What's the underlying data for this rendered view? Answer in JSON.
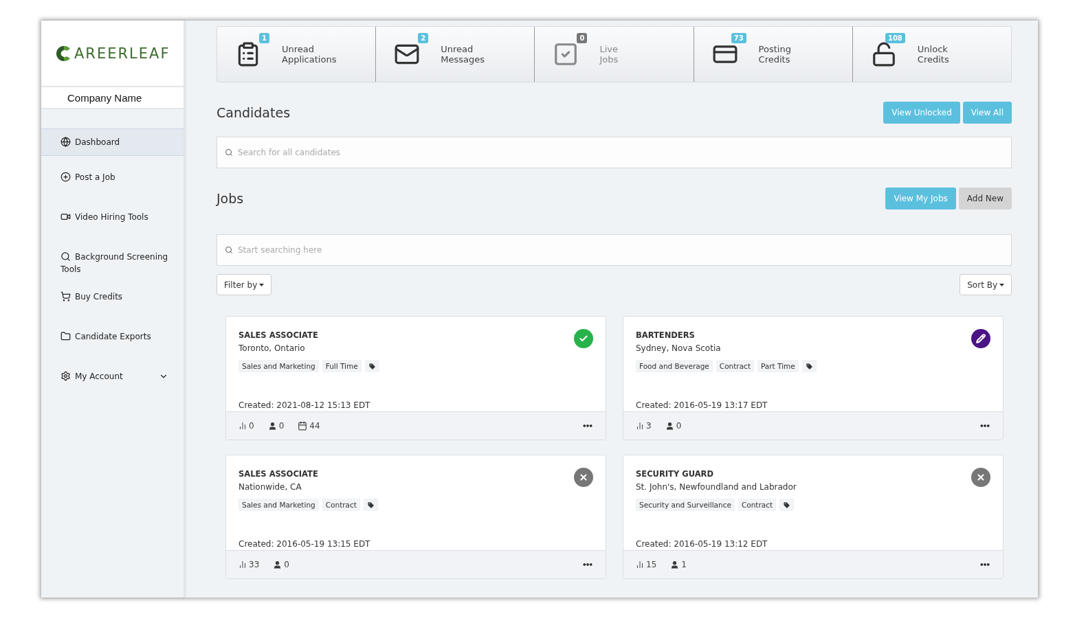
{
  "sidebar": {
    "logo": "AREERLEAF",
    "company": "Company Name",
    "items": [
      {
        "kind": "dashboard",
        "label": "Dashboard",
        "selected": true
      },
      {
        "kind": "post",
        "label": "Post a Job",
        "selected": false
      },
      {
        "kind": "video",
        "label": "Video Hiring Tools",
        "selected": false
      },
      {
        "kind": "screening",
        "label": "Background Screening Tools",
        "selected": false
      },
      {
        "kind": "credits",
        "label": "Buy Credits",
        "selected": false
      },
      {
        "kind": "exports",
        "label": "Candidate Exports",
        "selected": false
      },
      {
        "kind": "account",
        "label": "My Account",
        "selected": false,
        "expanded": false
      }
    ]
  },
  "stats": [
    {
      "kind": "applications",
      "count": "1",
      "label": [
        "Unread",
        "Applications"
      ],
      "muted": false
    },
    {
      "kind": "messages",
      "count": "2",
      "label": [
        "Unread",
        "Messages"
      ],
      "muted": false
    },
    {
      "kind": "jobs",
      "count": "0",
      "label": [
        "Live",
        "Jobs"
      ],
      "muted": true
    },
    {
      "kind": "posting",
      "count": "73",
      "label": [
        "Posting",
        "Credits"
      ],
      "muted": false
    },
    {
      "kind": "unlock",
      "count": "108",
      "label": [
        "Unlock",
        "Credits"
      ],
      "muted": false
    }
  ],
  "candidates": {
    "title": "Candidates",
    "buttons": [
      {
        "label": "View Unlocked",
        "kind": "primary"
      },
      {
        "label": "View All",
        "kind": "primary"
      }
    ],
    "search": {
      "placeholder": "Search for all candidates"
    }
  },
  "jobs": {
    "title": "Jobs",
    "buttons": [
      {
        "label": "View My Jobs",
        "kind": "primary"
      },
      {
        "label": "Add New",
        "kind": "secondary"
      }
    ],
    "search": {
      "placeholder": "Start searching here"
    },
    "filter": "Filter by",
    "sort": "Sort By",
    "cards": [
      {
        "title": "SALES ASSOCIATE",
        "location": "Toronto, Ontario",
        "tags": [
          "Sales and Marketing",
          "Full Time"
        ],
        "kind": "active",
        "created": "Created: 2021-08-12 15:13 EDT",
        "views": "0",
        "applicants": "0",
        "days": "44"
      },
      {
        "title": "BARTENDERS",
        "location": "Sydney, Nova Scotia",
        "tags": [
          "Food and Beverage",
          "Contract",
          "Part Time"
        ],
        "kind": "draft",
        "created": "Created: 2016-05-19 13:17 EDT",
        "views": "3",
        "applicants": "0"
      },
      {
        "title": "SALES ASSOCIATE",
        "location": "Nationwide, CA",
        "tags": [
          "Sales and Marketing",
          "Contract"
        ],
        "kind": "closed",
        "created": "Created: 2016-05-19 13:15 EDT",
        "views": "33",
        "applicants": "0"
      },
      {
        "title": "SECURITY GUARD",
        "location": "St. John's, Newfoundland and Labrador",
        "tags": [
          "Security and Surveillance",
          "Contract"
        ],
        "kind": "closed",
        "created": "Created: 2016-05-19 13:12 EDT",
        "views": "15",
        "applicants": "1"
      }
    ]
  }
}
